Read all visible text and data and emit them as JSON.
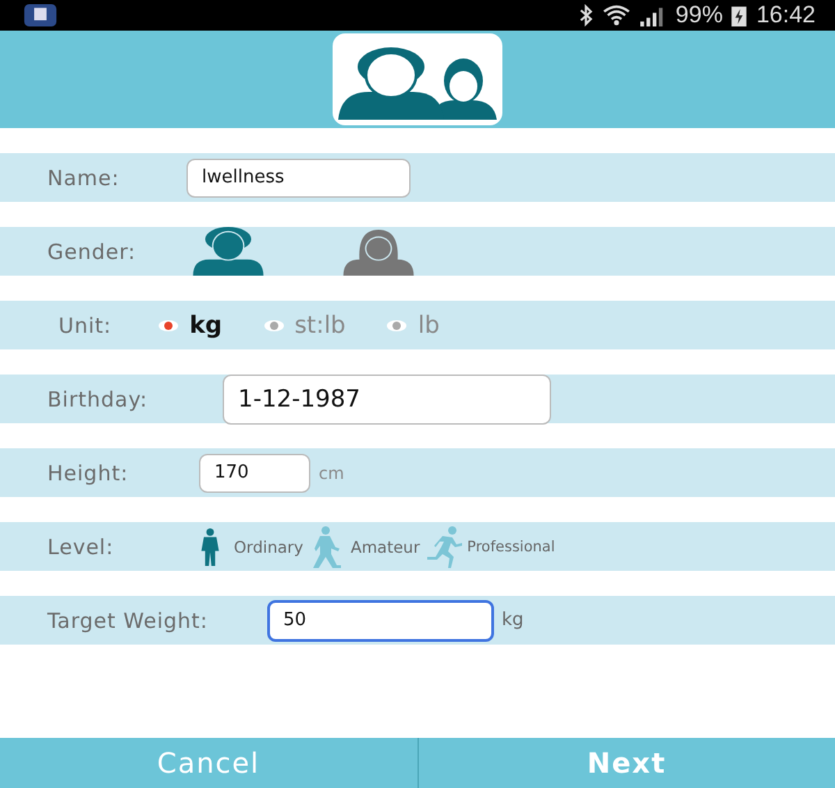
{
  "status_bar": {
    "battery": "99%",
    "time": "16:42"
  },
  "name": {
    "label": "Name:",
    "value": "lwellness"
  },
  "gender": {
    "label": "Gender:",
    "options": [
      {
        "kind": "male",
        "selected": true
      },
      {
        "kind": "female",
        "selected": false
      }
    ]
  },
  "unit": {
    "label": "Unit:",
    "options": [
      {
        "label": "kg",
        "selected": true
      },
      {
        "label": "st:lb",
        "selected": false
      },
      {
        "label": "lb",
        "selected": false
      }
    ]
  },
  "birthday": {
    "label": "Birthday:",
    "value": "1-12-1987"
  },
  "height": {
    "label": "Height:",
    "value": "170",
    "unit": "cm"
  },
  "level": {
    "label": "Level:",
    "options": [
      {
        "kind": "standing",
        "label": "Ordinary",
        "selected": true
      },
      {
        "kind": "walking",
        "label": "Amateur",
        "selected": false
      },
      {
        "kind": "running",
        "label": "Professional",
        "selected": false
      }
    ]
  },
  "target_weight": {
    "label": "Target Weight:",
    "value": "50",
    "unit": "kg",
    "focused": true
  },
  "buttons": [
    {
      "label": "Cancel"
    },
    {
      "label": "Next"
    }
  ]
}
